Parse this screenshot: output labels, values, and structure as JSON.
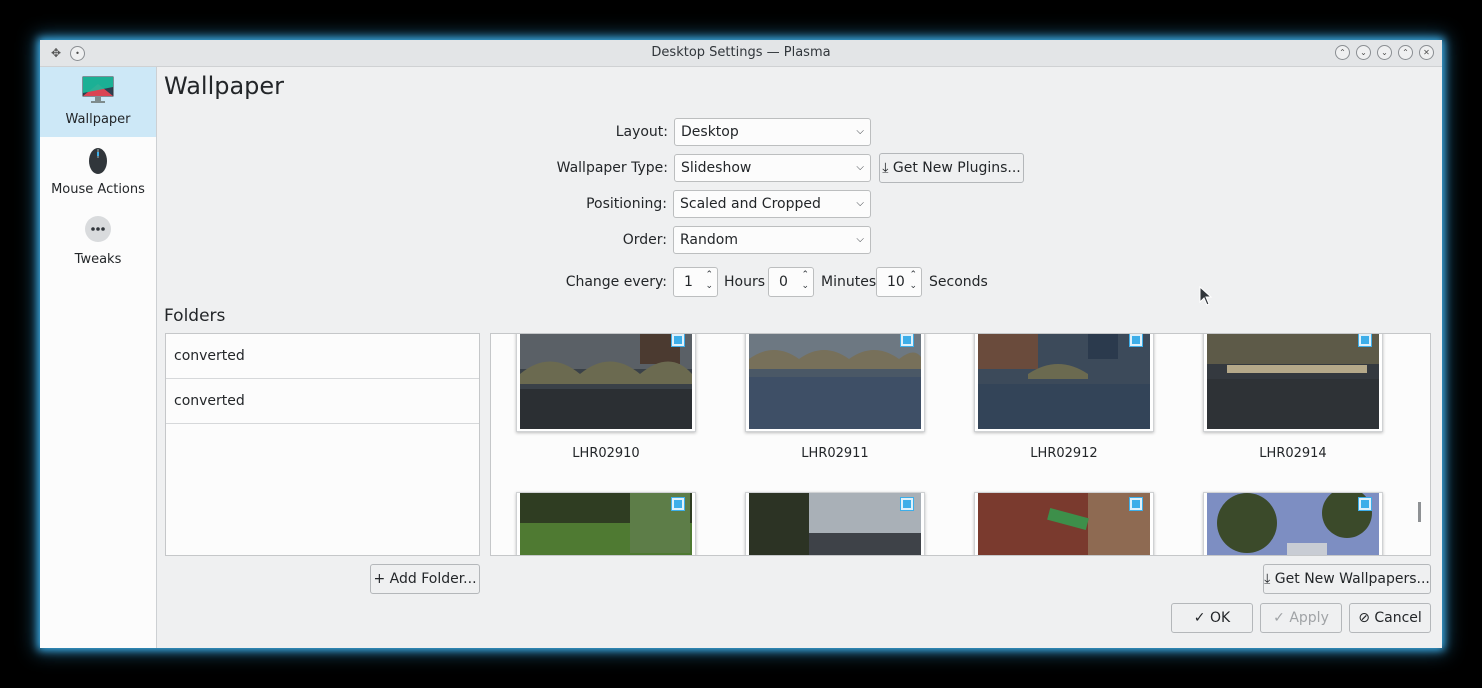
{
  "window": {
    "title": "Desktop Settings — Plasma",
    "left_buttons": [
      "pin-icon",
      "keep-icon"
    ],
    "right_buttons": [
      "keep-above-icon",
      "keep-below-icon",
      "minimize-icon",
      "maximize-icon",
      "close-icon"
    ]
  },
  "sidebar": {
    "items": [
      {
        "label": "Wallpaper",
        "icon": "monitor-icon",
        "active": true
      },
      {
        "label": "Mouse Actions",
        "icon": "mouse-icon",
        "active": false
      },
      {
        "label": "Tweaks",
        "icon": "more-icon",
        "active": false
      }
    ]
  },
  "page": {
    "heading": "Wallpaper",
    "layout_label": "Layout:",
    "layout_value": "Desktop",
    "wallpaper_type_label": "Wallpaper Type:",
    "wallpaper_type_value": "Slideshow",
    "get_plugins_label": "Get New Plugins...",
    "positioning_label": "Positioning:",
    "positioning_value": "Scaled and Cropped",
    "order_label": "Order:",
    "order_value": "Random",
    "change_every_label": "Change every:",
    "hours_value": "1",
    "hours_label": "Hours",
    "minutes_value": "0",
    "minutes_label": "Minutes",
    "seconds_value": "10",
    "seconds_label": "Seconds"
  },
  "folders": {
    "heading": "Folders",
    "items": [
      "converted",
      "converted"
    ],
    "add_folder_label": "Add Folder..."
  },
  "wallpapers": {
    "items": [
      {
        "name": "LHR02910",
        "checked": true
      },
      {
        "name": "LHR02911",
        "checked": true
      },
      {
        "name": "LHR02912",
        "checked": true
      },
      {
        "name": "LHR02914",
        "checked": true
      }
    ],
    "second_row_checked": [
      true,
      true,
      true,
      true
    ],
    "get_wallpapers_label": "Get New Wallpapers..."
  },
  "footer": {
    "ok_label": "OK",
    "apply_label": "Apply",
    "cancel_label": "Cancel"
  },
  "colors": {
    "accent": "#3daee9",
    "selection": "#cde8f7",
    "window_bg": "#eff0f1"
  }
}
